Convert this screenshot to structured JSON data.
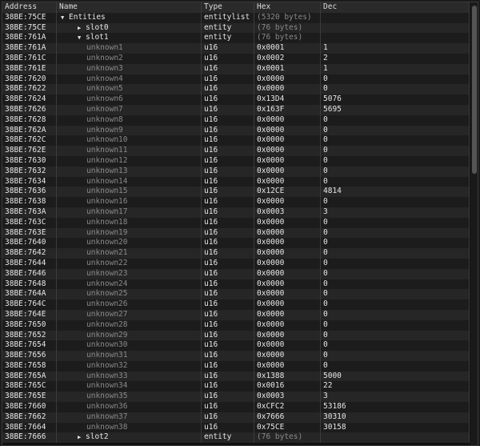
{
  "columns": {
    "address": "Address",
    "name": "Name",
    "type": "Type",
    "hex": "Hex",
    "dec": "Dec"
  },
  "rows": [
    {
      "addr": "38BE:75CE",
      "name": "Entities",
      "type": "entitylist",
      "hex": "(5320 bytes)",
      "dec": "",
      "level": 0,
      "expand": "▼"
    },
    {
      "addr": "38BE:75CE",
      "name": "slot0",
      "type": "entity",
      "hex": "(76 bytes)",
      "dec": "",
      "level": 1,
      "expand": "▶"
    },
    {
      "addr": "38BE:761A",
      "name": "slot1",
      "type": "entity",
      "hex": "(76 bytes)",
      "dec": "",
      "level": 1,
      "expand": "▼"
    },
    {
      "addr": "38BE:761A",
      "name": "unknown1",
      "type": "u16",
      "hex": "0x0001",
      "dec": "1",
      "level": 2
    },
    {
      "addr": "38BE:761C",
      "name": "unknown2",
      "type": "u16",
      "hex": "0x0002",
      "dec": "2",
      "level": 2
    },
    {
      "addr": "38BE:761E",
      "name": "unknown3",
      "type": "u16",
      "hex": "0x0001",
      "dec": "1",
      "level": 2
    },
    {
      "addr": "38BE:7620",
      "name": "unknown4",
      "type": "u16",
      "hex": "0x0000",
      "dec": "0",
      "level": 2
    },
    {
      "addr": "38BE:7622",
      "name": "unknown5",
      "type": "u16",
      "hex": "0x0000",
      "dec": "0",
      "level": 2
    },
    {
      "addr": "38BE:7624",
      "name": "unknown6",
      "type": "u16",
      "hex": "0x13D4",
      "dec": "5076",
      "level": 2
    },
    {
      "addr": "38BE:7626",
      "name": "unknown7",
      "type": "u16",
      "hex": "0x163F",
      "dec": "5695",
      "level": 2
    },
    {
      "addr": "38BE:7628",
      "name": "unknown8",
      "type": "u16",
      "hex": "0x0000",
      "dec": "0",
      "level": 2
    },
    {
      "addr": "38BE:762A",
      "name": "unknown9",
      "type": "u16",
      "hex": "0x0000",
      "dec": "0",
      "level": 2
    },
    {
      "addr": "38BE:762C",
      "name": "unknown10",
      "type": "u16",
      "hex": "0x0000",
      "dec": "0",
      "level": 2
    },
    {
      "addr": "38BE:762E",
      "name": "unknown11",
      "type": "u16",
      "hex": "0x0000",
      "dec": "0",
      "level": 2
    },
    {
      "addr": "38BE:7630",
      "name": "unknown12",
      "type": "u16",
      "hex": "0x0000",
      "dec": "0",
      "level": 2
    },
    {
      "addr": "38BE:7632",
      "name": "unknown13",
      "type": "u16",
      "hex": "0x0000",
      "dec": "0",
      "level": 2
    },
    {
      "addr": "38BE:7634",
      "name": "unknown14",
      "type": "u16",
      "hex": "0x0000",
      "dec": "0",
      "level": 2
    },
    {
      "addr": "38BE:7636",
      "name": "unknown15",
      "type": "u16",
      "hex": "0x12CE",
      "dec": "4814",
      "level": 2
    },
    {
      "addr": "38BE:7638",
      "name": "unknown16",
      "type": "u16",
      "hex": "0x0000",
      "dec": "0",
      "level": 2
    },
    {
      "addr": "38BE:763A",
      "name": "unknown17",
      "type": "u16",
      "hex": "0x0003",
      "dec": "3",
      "level": 2
    },
    {
      "addr": "38BE:763C",
      "name": "unknown18",
      "type": "u16",
      "hex": "0x0000",
      "dec": "0",
      "level": 2
    },
    {
      "addr": "38BE:763E",
      "name": "unknown19",
      "type": "u16",
      "hex": "0x0000",
      "dec": "0",
      "level": 2
    },
    {
      "addr": "38BE:7640",
      "name": "unknown20",
      "type": "u16",
      "hex": "0x0000",
      "dec": "0",
      "level": 2
    },
    {
      "addr": "38BE:7642",
      "name": "unknown21",
      "type": "u16",
      "hex": "0x0000",
      "dec": "0",
      "level": 2
    },
    {
      "addr": "38BE:7644",
      "name": "unknown22",
      "type": "u16",
      "hex": "0x0000",
      "dec": "0",
      "level": 2
    },
    {
      "addr": "38BE:7646",
      "name": "unknown23",
      "type": "u16",
      "hex": "0x0000",
      "dec": "0",
      "level": 2
    },
    {
      "addr": "38BE:7648",
      "name": "unknown24",
      "type": "u16",
      "hex": "0x0000",
      "dec": "0",
      "level": 2
    },
    {
      "addr": "38BE:764A",
      "name": "unknown25",
      "type": "u16",
      "hex": "0x0000",
      "dec": "0",
      "level": 2
    },
    {
      "addr": "38BE:764C",
      "name": "unknown26",
      "type": "u16",
      "hex": "0x0000",
      "dec": "0",
      "level": 2
    },
    {
      "addr": "38BE:764E",
      "name": "unknown27",
      "type": "u16",
      "hex": "0x0000",
      "dec": "0",
      "level": 2
    },
    {
      "addr": "38BE:7650",
      "name": "unknown28",
      "type": "u16",
      "hex": "0x0000",
      "dec": "0",
      "level": 2
    },
    {
      "addr": "38BE:7652",
      "name": "unknown29",
      "type": "u16",
      "hex": "0x0000",
      "dec": "0",
      "level": 2
    },
    {
      "addr": "38BE:7654",
      "name": "unknown30",
      "type": "u16",
      "hex": "0x0000",
      "dec": "0",
      "level": 2
    },
    {
      "addr": "38BE:7656",
      "name": "unknown31",
      "type": "u16",
      "hex": "0x0000",
      "dec": "0",
      "level": 2
    },
    {
      "addr": "38BE:7658",
      "name": "unknown32",
      "type": "u16",
      "hex": "0x0000",
      "dec": "0",
      "level": 2
    },
    {
      "addr": "38BE:765A",
      "name": "unknown33",
      "type": "u16",
      "hex": "0x1388",
      "dec": "5000",
      "level": 2
    },
    {
      "addr": "38BE:765C",
      "name": "unknown34",
      "type": "u16",
      "hex": "0x0016",
      "dec": "22",
      "level": 2
    },
    {
      "addr": "38BE:765E",
      "name": "unknown35",
      "type": "u16",
      "hex": "0x0003",
      "dec": "3",
      "level": 2
    },
    {
      "addr": "38BE:7660",
      "name": "unknown36",
      "type": "u16",
      "hex": "0xCFC2",
      "dec": "53186",
      "level": 2
    },
    {
      "addr": "38BE:7662",
      "name": "unknown37",
      "type": "u16",
      "hex": "0x7666",
      "dec": "30310",
      "level": 2
    },
    {
      "addr": "38BE:7664",
      "name": "unknown38",
      "type": "u16",
      "hex": "0x75CE",
      "dec": "30158",
      "level": 2
    },
    {
      "addr": "38BE:7666",
      "name": "slot2",
      "type": "entity",
      "hex": "(76 bytes)",
      "dec": "",
      "level": 1,
      "expand": "▶"
    }
  ]
}
